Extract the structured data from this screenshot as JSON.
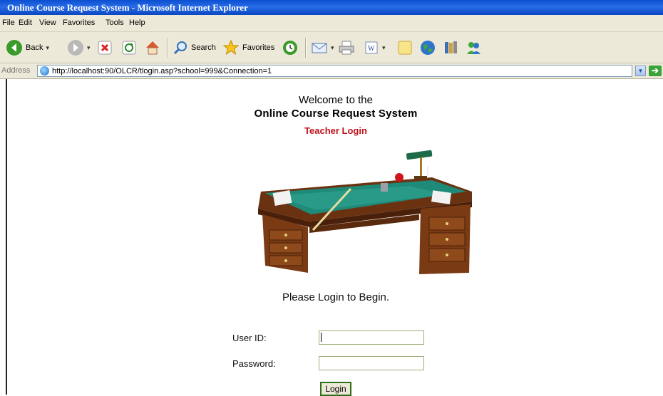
{
  "window": {
    "title": "Online Course Request System - Microsoft Internet Explorer"
  },
  "menu": {
    "items": [
      "File",
      "Edit",
      "View",
      "Favorites",
      "Tools",
      "Help"
    ]
  },
  "toolbar": {
    "back_label": "Back",
    "search_label": "Search",
    "favorites_label": "Favorites"
  },
  "address": {
    "label": "Address",
    "url": "http://localhost:90/OLCR/tlogin.asp?school=999&Connection=1"
  },
  "page": {
    "welcome_line1": "Welcome to the",
    "welcome_line2": "Online Course Request System",
    "subtitle": "Teacher Login",
    "prompt": "Please Login to Begin.",
    "userid_label": "User ID:",
    "userid_value": "",
    "password_label": "Password:",
    "password_value": "",
    "login_button": "Login"
  },
  "colors": {
    "subtitle": "#c0101a",
    "titlebar": "#0b4ed1",
    "chrome": "#ece9d8"
  }
}
